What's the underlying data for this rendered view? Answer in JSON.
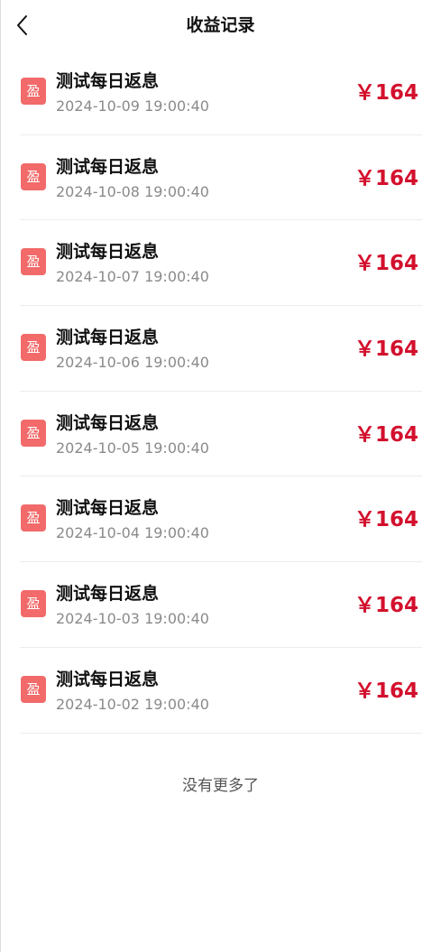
{
  "header": {
    "title": "收益记录",
    "back_icon": "chevron-left-icon"
  },
  "records": [
    {
      "badge": "盈",
      "title": "测试每日返息",
      "time": "2024-10-09 19:00:40",
      "amount": "￥164"
    },
    {
      "badge": "盈",
      "title": "测试每日返息",
      "time": "2024-10-08 19:00:40",
      "amount": "￥164"
    },
    {
      "badge": "盈",
      "title": "测试每日返息",
      "time": "2024-10-07 19:00:40",
      "amount": "￥164"
    },
    {
      "badge": "盈",
      "title": "测试每日返息",
      "time": "2024-10-06 19:00:40",
      "amount": "￥164"
    },
    {
      "badge": "盈",
      "title": "测试每日返息",
      "time": "2024-10-05 19:00:40",
      "amount": "￥164"
    },
    {
      "badge": "盈",
      "title": "测试每日返息",
      "time": "2024-10-04 19:00:40",
      "amount": "￥164"
    },
    {
      "badge": "盈",
      "title": "测试每日返息",
      "time": "2024-10-03 19:00:40",
      "amount": "￥164"
    },
    {
      "badge": "盈",
      "title": "测试每日返息",
      "time": "2024-10-02 19:00:40",
      "amount": "￥164"
    }
  ],
  "footer": {
    "no_more": "没有更多了"
  },
  "colors": {
    "badge_bg": "#f26a6a",
    "amount": "#d3102d",
    "time": "#8a8a8a"
  }
}
